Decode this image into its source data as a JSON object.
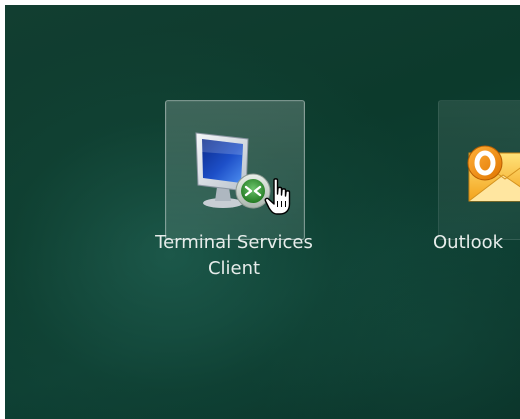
{
  "desktop": {
    "apps": [
      {
        "label_line1": "Terminal Services",
        "label_line2": "Client",
        "icon": "remote-desktop-icon",
        "state": "hovered"
      },
      {
        "label": "Outlook",
        "icon": "outlook-icon",
        "state": "normal"
      }
    ]
  },
  "cursor": {
    "icon": "hand-pointer-icon"
  },
  "colors": {
    "background": "#0d3b2e",
    "label_text": "#e6ecea",
    "monitor_screen": "#1d4fc8",
    "remote_badge": "#2f8a2f",
    "outlook_orange": "#f0a020"
  }
}
